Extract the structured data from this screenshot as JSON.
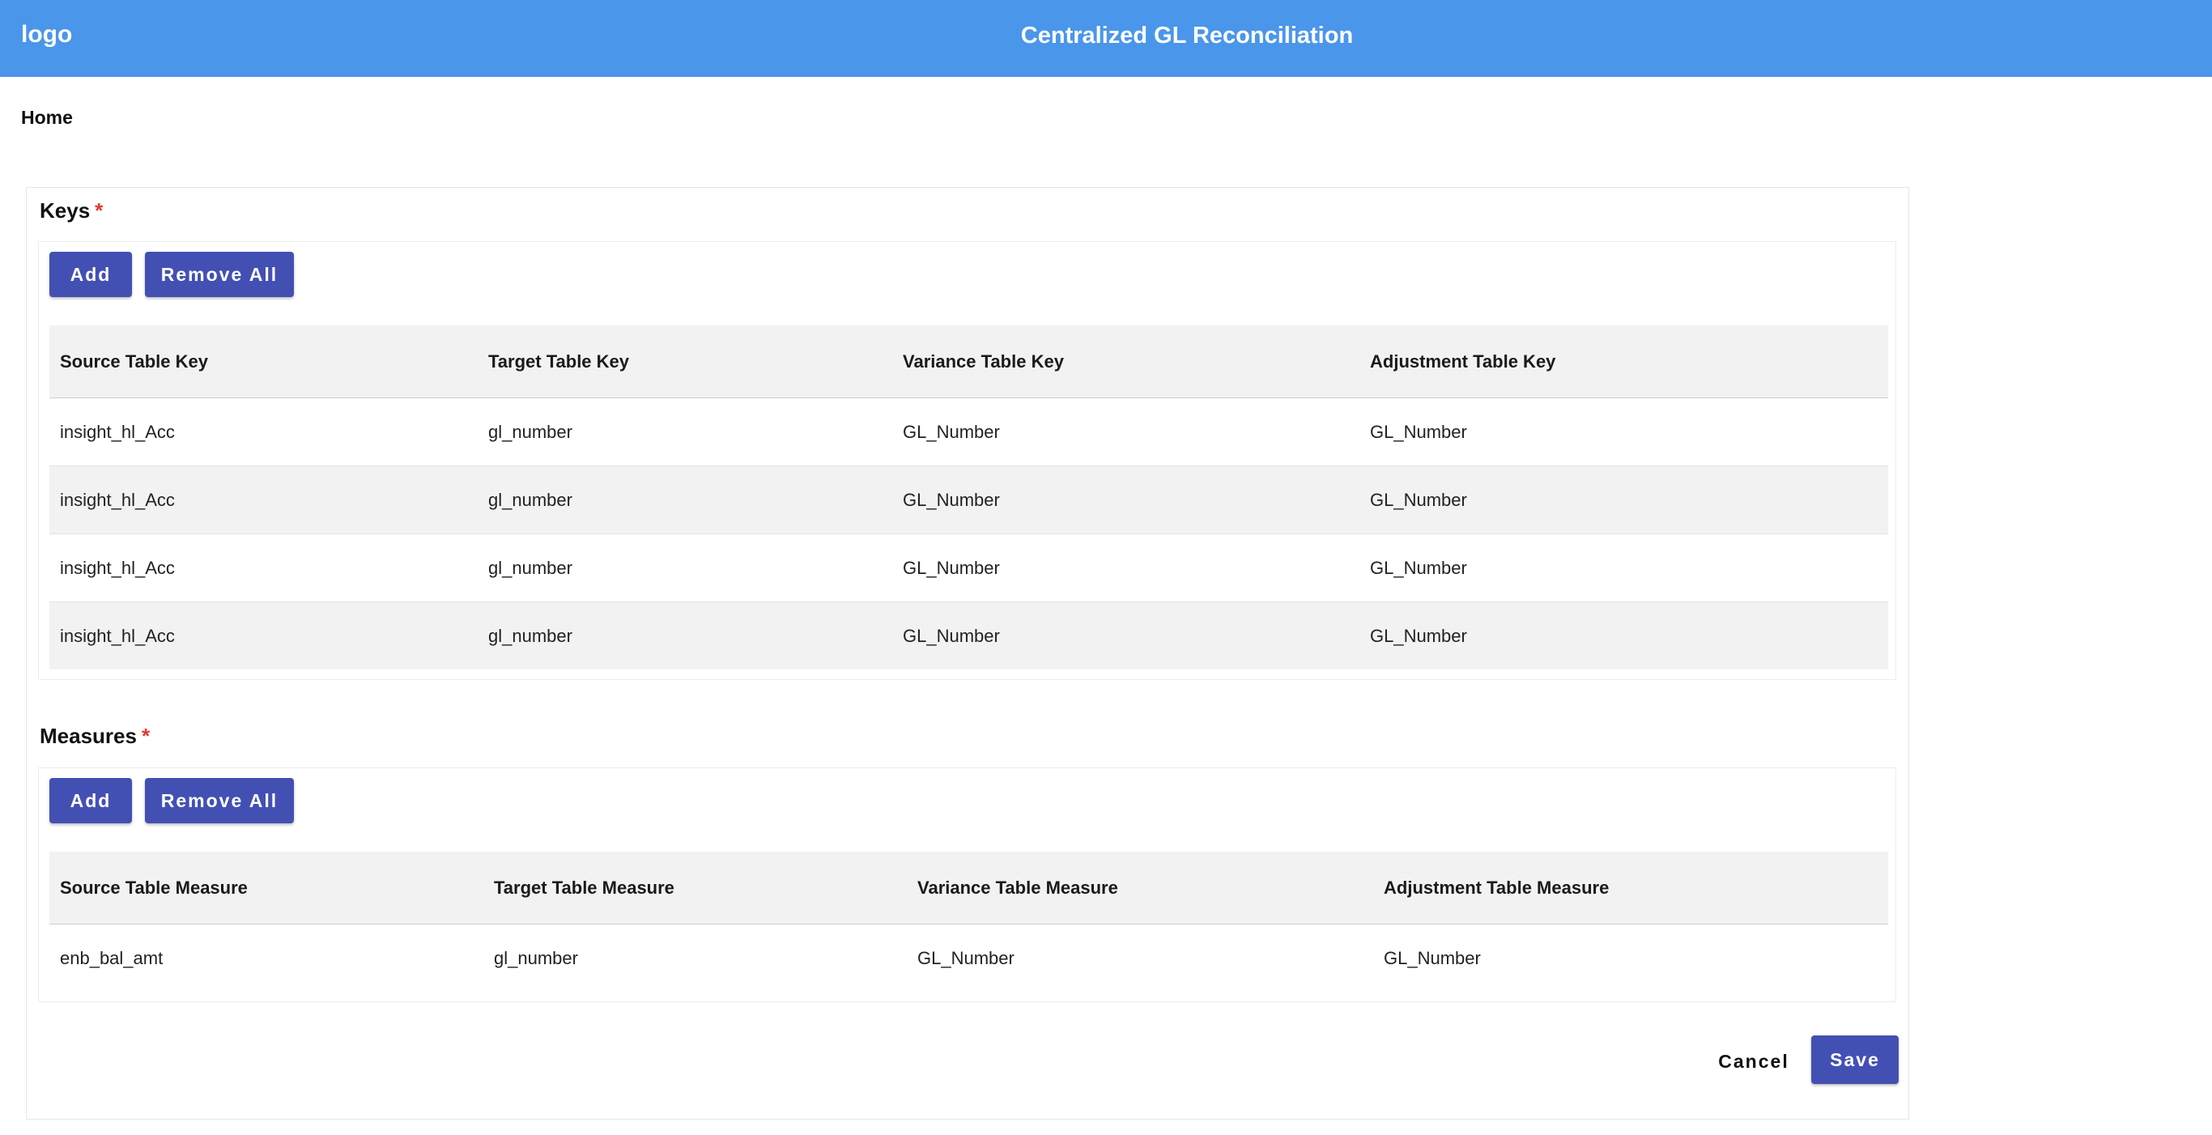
{
  "header": {
    "logo": "logo",
    "title": "Centralized GL Reconciliation"
  },
  "breadcrumb": {
    "home": "Home"
  },
  "keys": {
    "title": "Keys",
    "required_mark": "*",
    "add_label": "Add",
    "remove_all_label": "Remove All",
    "columns": [
      "Source Table Key",
      "Target Table Key",
      "Variance Table Key",
      "Adjustment Table Key"
    ],
    "rows": [
      [
        "insight_hl_Acc",
        "gl_number",
        "GL_Number",
        "GL_Number"
      ],
      [
        "insight_hl_Acc",
        "gl_number",
        "GL_Number",
        "GL_Number"
      ],
      [
        "insight_hl_Acc",
        "gl_number",
        "GL_Number",
        "GL_Number"
      ],
      [
        "insight_hl_Acc",
        "gl_number",
        "GL_Number",
        "GL_Number"
      ]
    ]
  },
  "measures": {
    "title": "Measures",
    "required_mark": "*",
    "add_label": "Add",
    "remove_all_label": "Remove All",
    "columns": [
      "Source Table Measure",
      "Target Table Measure",
      "Variance Table Measure",
      "Adjustment Table Measure"
    ],
    "rows": [
      [
        "enb_bal_amt",
        "gl_number",
        "GL_Number",
        "GL_Number"
      ]
    ]
  },
  "footer": {
    "cancel_label": "Cancel",
    "save_label": "Save"
  },
  "colors": {
    "header": "#4a96ea",
    "primary_button": "#4350b3",
    "required": "#e53935"
  }
}
